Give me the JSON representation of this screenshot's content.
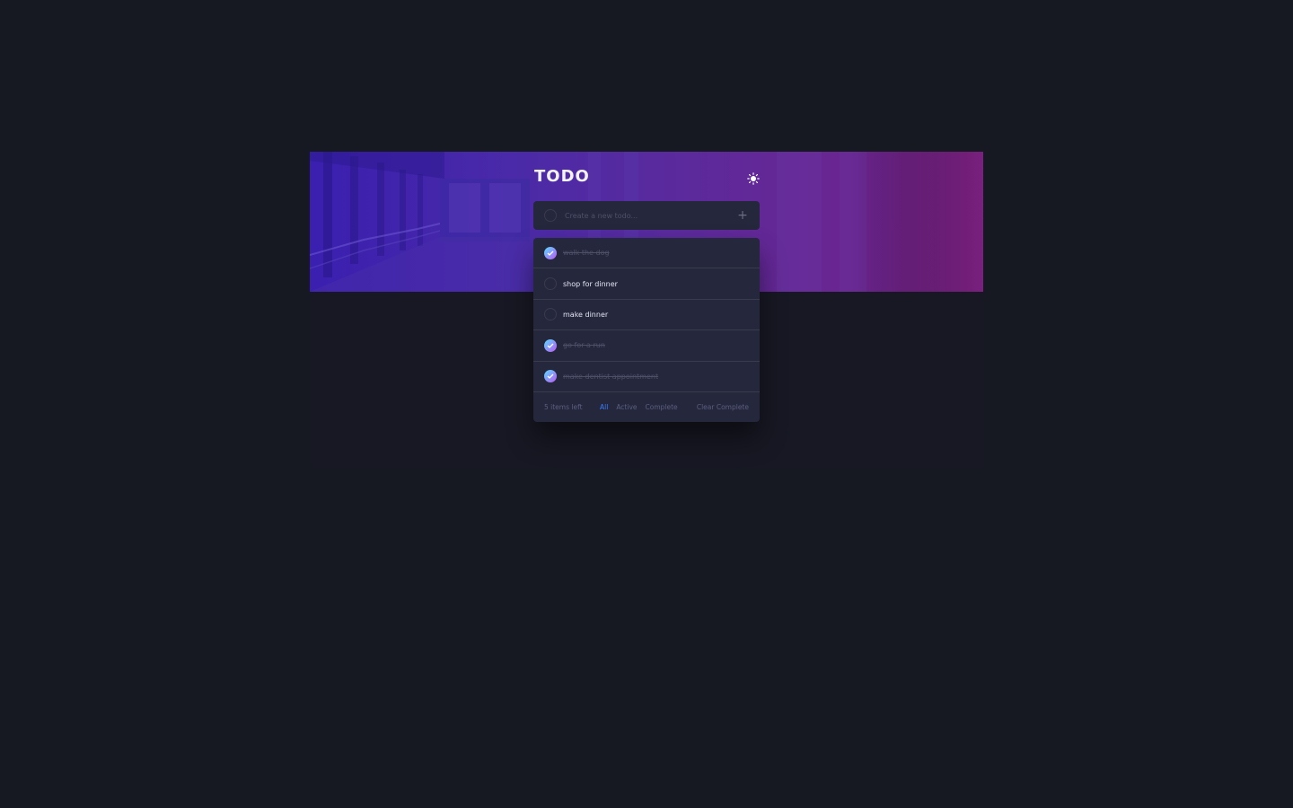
{
  "app": {
    "title": "TODO",
    "theme_toggle_icon": "sun-icon"
  },
  "new_todo": {
    "placeholder": "Create a new todo...",
    "value": "",
    "add_icon": "plus-icon",
    "add_label": "+"
  },
  "todos": [
    {
      "text": "walk the dog",
      "completed": true
    },
    {
      "text": "shop for dinner",
      "completed": false
    },
    {
      "text": "make dinner",
      "completed": false
    },
    {
      "text": "go for a run",
      "completed": true
    },
    {
      "text": "make dentist appointment",
      "completed": true
    }
  ],
  "footer": {
    "items_left": "5 items left",
    "filters": [
      "All",
      "Active",
      "Complete"
    ],
    "active_filter": "All",
    "clear_label": "Clear Complete"
  },
  "colors": {
    "page_background": "#161922",
    "card_background": "#25273d",
    "check_gradient_start": "#55ddff",
    "check_gradient_end": "#c058f3",
    "active_filter": "#3a7cfd"
  }
}
